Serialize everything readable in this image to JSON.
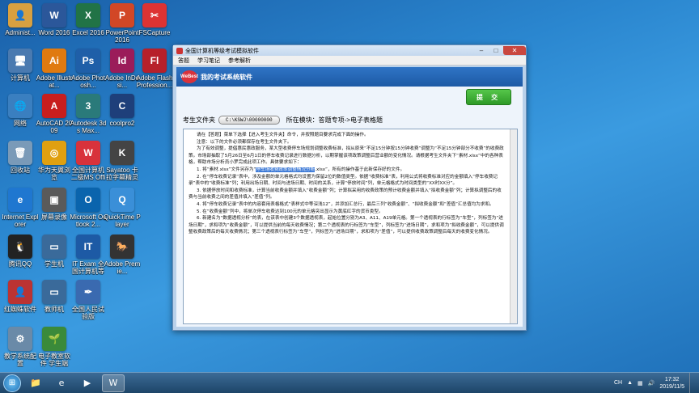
{
  "desktop_icons": [
    {
      "label": "Administ...",
      "glyph": "👤",
      "color": "#d8a040",
      "col": 0,
      "row": 0
    },
    {
      "label": "Word 2016",
      "glyph": "W",
      "color": "#2b579a",
      "col": 1,
      "row": 0
    },
    {
      "label": "Excel 2016",
      "glyph": "X",
      "color": "#217346",
      "col": 2,
      "row": 0
    },
    {
      "label": "PowerPoint 2016",
      "glyph": "P",
      "color": "#d24726",
      "col": 3,
      "row": 0
    },
    {
      "label": "FSCapture",
      "glyph": "✂",
      "color": "#d33",
      "col": 4,
      "row": 0
    },
    {
      "label": "计算机",
      "glyph": "🖥",
      "color": "#4a7ab0",
      "col": 0,
      "row": 1
    },
    {
      "label": "Adobe Illustrat...",
      "glyph": "Ai",
      "color": "#e07a10",
      "col": 1,
      "row": 1
    },
    {
      "label": "Adobe Photosh...",
      "glyph": "Ps",
      "color": "#1f5fa8",
      "col": 2,
      "row": 1
    },
    {
      "label": "Adobe InDesi...",
      "glyph": "Id",
      "color": "#9b1c5a",
      "col": 3,
      "row": 1
    },
    {
      "label": "Adobe Flash Profession...",
      "glyph": "Fl",
      "color": "#b7202a",
      "col": 4,
      "row": 1
    },
    {
      "label": "网络",
      "glyph": "🌐",
      "color": "#3a7fc0",
      "col": 0,
      "row": 2
    },
    {
      "label": "AutoCAD 2009",
      "glyph": "A",
      "color": "#c81e1e",
      "col": 1,
      "row": 2
    },
    {
      "label": "Autodesk 3ds Max...",
      "glyph": "3",
      "color": "#2a7a7a",
      "col": 2,
      "row": 2
    },
    {
      "label": "coolpro2",
      "glyph": "C",
      "color": "#1e3f7a",
      "col": 3,
      "row": 2
    },
    {
      "label": "回收站",
      "glyph": "🗑",
      "color": "#7a9ab8",
      "col": 0,
      "row": 3
    },
    {
      "label": "华为天翼浏览",
      "glyph": "◎",
      "color": "#e0a010",
      "col": 1,
      "row": 3
    },
    {
      "label": "全国计算机二级MS Offic...",
      "glyph": "W",
      "color": "#d8323b",
      "col": 2,
      "row": 3
    },
    {
      "label": "Sayatoo 卡拉字幕精灵",
      "glyph": "K",
      "color": "#444",
      "col": 3,
      "row": 3
    },
    {
      "label": "Internet Explorer",
      "glyph": "e",
      "color": "#1f77d0",
      "col": 0,
      "row": 4
    },
    {
      "label": "屏幕录像",
      "glyph": "▣",
      "color": "#5a5a5a",
      "col": 1,
      "row": 4
    },
    {
      "label": "Microsoft Outlook 2...",
      "glyph": "O",
      "color": "#0a64ad",
      "col": 2,
      "row": 4
    },
    {
      "label": "QuickTime Player",
      "glyph": "Q",
      "color": "#3a8fd8",
      "col": 3,
      "row": 4
    },
    {
      "label": "腾讯QQ",
      "glyph": "🐧",
      "color": "#222",
      "col": 0,
      "row": 5
    },
    {
      "label": "学生机",
      "glyph": "▭",
      "color": "#3a6a9a",
      "col": 1,
      "row": 5
    },
    {
      "label": "IT Exam 全国计算机等级考试...",
      "glyph": "IT",
      "color": "#1d5aa5",
      "col": 2,
      "row": 5
    },
    {
      "label": "Adobe Premie...",
      "glyph": "🐎",
      "color": "#333",
      "col": 3,
      "row": 5
    },
    {
      "label": "红蜘蛛软件",
      "glyph": "👤",
      "color": "#b33",
      "col": 0,
      "row": 6
    },
    {
      "label": "教师机",
      "glyph": "▭",
      "color": "#3a6a9a",
      "col": 1,
      "row": 6
    },
    {
      "label": "全国人民试验版",
      "glyph": "✒",
      "color": "#3a6ab0",
      "col": 2,
      "row": 6
    },
    {
      "label": "教学系统配置",
      "glyph": "⚙",
      "color": "#6a8aa8",
      "col": 0,
      "row": 7
    },
    {
      "label": "电子教室软件 学生端",
      "glyph": "🌱",
      "color": "#3a8a3a",
      "col": 1,
      "row": 7
    }
  ],
  "window": {
    "title": "全国计算机等级考试模拟软件",
    "menu": [
      "答题",
      "学习笔记",
      "参考解析"
    ],
    "banner_title": "我的考试系统软件",
    "logo_text": "WeBest",
    "submit_label": "提 交",
    "path_label": "考生文件夹",
    "path_value": "C:\\KSWJ\\00000000",
    "module_label": "所在模块：答题专项->电子表格题",
    "paragraphs": [
      "请在【答题】菜单下选择【进入考生文件夹】命令，并按照题目要求完成下面的操作。",
      "注意：以下的文件必须都保存在考生文件夹下。",
      "为了有效调整，提倡惠民惠政服务，某大型收费停车场规划调整收费标准，拟从原来“不足15分钟按15分钟收费”调整为“不足15分钟部分不收费”的收费政策。市场部抽取了5月26日至6月1日的停车收费记录进行数据分析，以期掌握该项政策调整后营业额的变化情况。请根据考生文件夹下“素材.xlsx”中的各种表格，帮助市场分析员小罗完成此项工作。具体要求如下：",
      "1. 将“素材.xlsx”文件另存为“",
      "停车场收费政策调整情况分析",
      ".xlsx”，所有的操作基于此新保存好的文件。",
      "2. 在“停车收费记录”表中，涉及金额的单元格格式均设置为保留2位的数值类型。依据“收费标准”表，利用公式将收费标准对应的金额填入“停车收费记录”表中的“收费标准”列；利用出场日期、时间与进场日期、时间的关系，计算“停放时间”列，单元格格式为时间类型的“XX时XX分”。",
      "3. 依据停放时间和收费标准，计算当前收费金额并填入“收费金额”列；计算拟采用的收费政策的预计收费金额并填入“拟收费金额”列；计算拟调整后的收费与当前收费之间的差值并填入“差值”列。",
      "4. 将“停车收费记录”表中的内容套用表格格式“表样式中等深浅12”，并添加汇总行，最后三列“收费金额”、“拟收费金额”和“差值”汇总值均为求和。",
      "5. 在“收费金额”列中，将单次停车收费达到100元的单元格突出显示为黄底红字的货币类型。",
      "6. 新建名为“数据透视分析”的表，在该表中创建3个数据透视表，起始位置分别为A3、A11、A19单元格。第一个透视表的行标签为“车型”，列标签为“进场日期”，求和项为“收费金额”，可以提供当前的每天收费情况；第二个透视表的行标签为“车型”，列标签为“进场日期”，求和项为“拟收费金额”，可以提供调整收费政策后的每天收费情况；第三个透视表行标签为“车型”，列标签为“进场日期”，求和项为“差值”，可以提供收费政策调整后每天的收费变化情况。"
    ]
  },
  "taskbar": {
    "start_glyph": "⊞",
    "apps": [
      {
        "name": "explorer-app",
        "glyph": "📁",
        "active": false
      },
      {
        "name": "ie-app",
        "glyph": "e",
        "active": false
      },
      {
        "name": "media-app",
        "glyph": "▶",
        "active": false
      },
      {
        "name": "exam-app",
        "glyph": "W",
        "active": true
      }
    ],
    "tray_lang": "CH",
    "time": "17:32",
    "date": "2019/11/5"
  }
}
